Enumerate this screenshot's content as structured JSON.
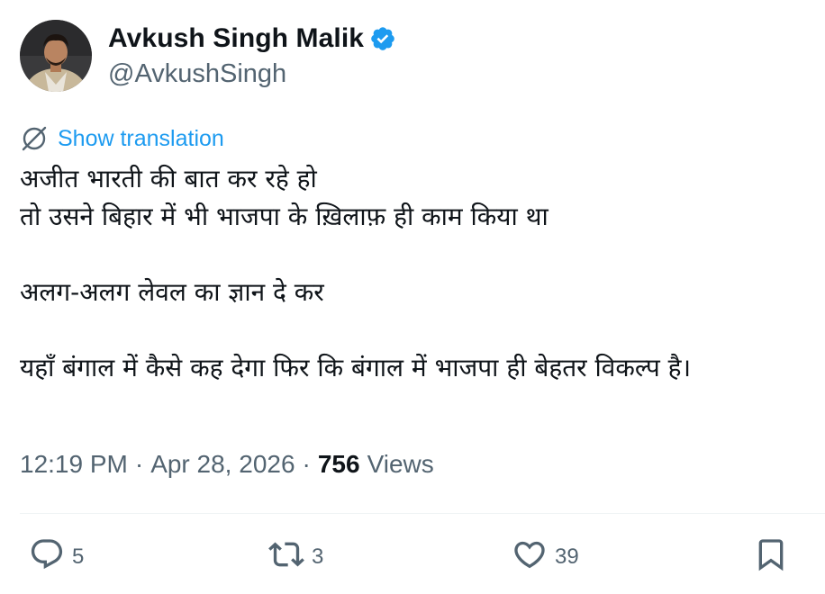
{
  "author": {
    "display_name": "Avkush Singh Malik",
    "handle": "@AvkushSingh",
    "verified": true
  },
  "translation": {
    "label": "Show translation"
  },
  "tweet": {
    "lines": [
      "अजीत भारती की बात कर रहे हो",
      "तो उसने बिहार में भी भाजपा के ख़िलाफ़ ही काम किया था",
      "",
      "अलग-अलग लेवल का ज्ञान दे कर",
      "",
      "यहाँ बंगाल में कैसे कह देगा फिर कि बंगाल में भाजपा ही बेहतर विकल्प है।"
    ]
  },
  "meta": {
    "time": "12:19 PM",
    "separator": "·",
    "date": "Apr 28, 2026",
    "views_count": "756",
    "views_label": "Views"
  },
  "actions": {
    "reply_count": "5",
    "retweet_count": "3",
    "like_count": "39"
  },
  "colors": {
    "accent": "#1d9bf0",
    "text_primary": "#0f1419",
    "text_secondary": "#536471",
    "divider": "#eff3f4"
  },
  "icons": [
    "verified-badge-icon",
    "translate-icon",
    "reply-icon",
    "retweet-icon",
    "like-icon",
    "bookmark-icon"
  ]
}
